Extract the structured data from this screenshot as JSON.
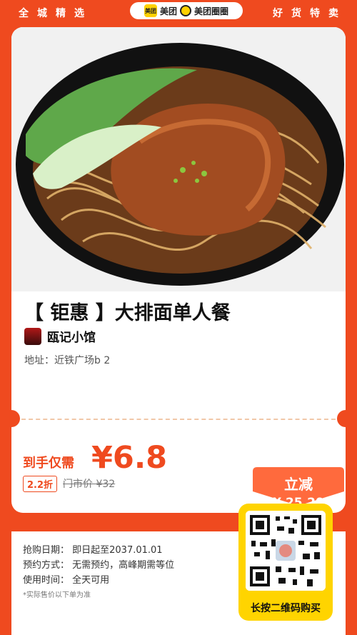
{
  "header": {
    "left_text": "全城精选",
    "right_text": "好货特卖",
    "brand_logo_text": "美团",
    "brand_name": "美团",
    "brand_name2": "美团圈圈"
  },
  "product": {
    "title": "【 钜惠 】大排面单人餐",
    "shop_name": "瓯记小馆",
    "address": "地址：近铁广场b    2"
  },
  "pricing": {
    "price_label": "到手仅需",
    "price_value": "¥6.8",
    "discount_badge": "2.2折",
    "original_price": "门市价 ¥32",
    "save_title": "立减",
    "save_amount": "¥ 25.20"
  },
  "info": {
    "purchase_date": "抢购日期：  即日起至2037.01.01",
    "reservation": "预约方式：  无需预约，高峰期需等位",
    "usage_time": "使用时间：  全天可用",
    "note": "*实际售价以下单为准"
  },
  "qr": {
    "label": "长按二维码购买"
  },
  "colors": {
    "accent": "#ef4a1f",
    "yellow": "#ffd400"
  }
}
